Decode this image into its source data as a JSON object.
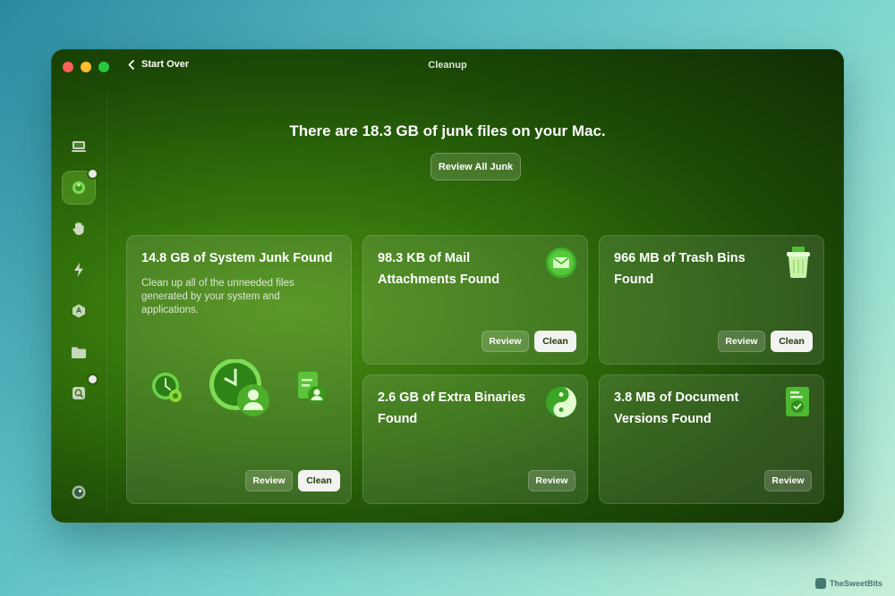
{
  "window": {
    "title": "Cleanup",
    "back_label": "Start Over"
  },
  "sidebar": {
    "items": [
      {
        "icon": "computer-icon",
        "active": false,
        "badge": false
      },
      {
        "icon": "cleanup-icon",
        "active": true,
        "badge": true
      },
      {
        "icon": "protection-hand-icon",
        "active": false,
        "badge": false
      },
      {
        "icon": "performance-bolt-icon",
        "active": false,
        "badge": false
      },
      {
        "icon": "applications-icon",
        "active": false,
        "badge": false
      },
      {
        "icon": "my-clutter-folder-icon",
        "active": false,
        "badge": false
      },
      {
        "icon": "space-lens-icon",
        "active": false,
        "badge": true
      },
      {
        "icon": "assistant-icon",
        "active": false,
        "badge": false
      }
    ]
  },
  "main": {
    "headline": "There are 18.3 GB of junk files on your Mac.",
    "review_all_label": "Review All Junk"
  },
  "cards": {
    "system": {
      "title": "14.8 GB of System Junk Found",
      "desc": "Clean up all of the unneeded files generated by your system and applications.",
      "review": "Review",
      "clean": "Clean"
    },
    "mail": {
      "title_line1": "98.3 KB of Mail",
      "title_line2": "Attachments Found",
      "review": "Review",
      "clean": "Clean"
    },
    "trash": {
      "title_line1": "966 MB of Trash Bins",
      "title_line2": "Found",
      "review": "Review",
      "clean": "Clean"
    },
    "binaries": {
      "title_line1": "2.6 GB of Extra Binaries",
      "title_line2": "Found",
      "review": "Review"
    },
    "documents": {
      "title_line1": "3.8 MB of Document",
      "title_line2": "Versions Found",
      "review": "Review"
    }
  },
  "watermark": "TheSweetBits",
  "colors": {
    "accent": "#4fb83a",
    "clean_button_bg": "#f2f2f0",
    "window_bg": "#1c4a06"
  }
}
